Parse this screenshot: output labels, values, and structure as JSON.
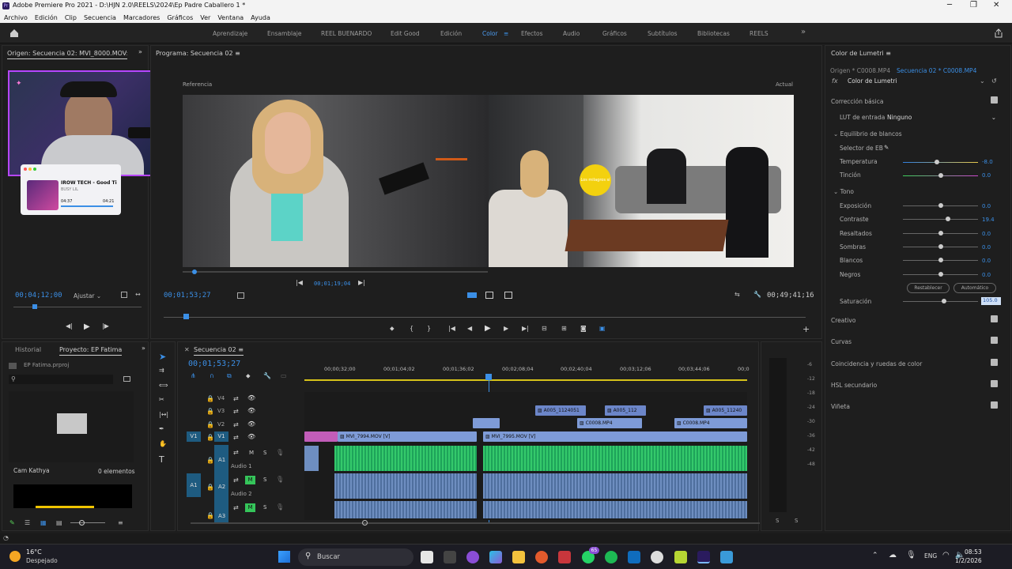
{
  "window": {
    "title": "Adobe Premiere Pro 2021 - D:\\HJN 2.0\\REELS\\2024\\Ep Padre Caballero 1 *",
    "minimize": "─",
    "maximize": "❐",
    "close": "✕"
  },
  "menu": [
    "Archivo",
    "Edición",
    "Clip",
    "Secuencia",
    "Marcadores",
    "Gráficos",
    "Ver",
    "Ventana",
    "Ayuda"
  ],
  "workspaces": [
    {
      "label": "Aprendizaje"
    },
    {
      "label": "Ensamblaje"
    },
    {
      "label": "REEL BUENARDO"
    },
    {
      "label": "Edit Good"
    },
    {
      "label": "Edición"
    },
    {
      "label": "Color",
      "active": true
    },
    {
      "label": "Efectos"
    },
    {
      "label": "Audio"
    },
    {
      "label": "Gráficos"
    },
    {
      "label": "Subtítulos"
    },
    {
      "label": "Bibliotecas"
    },
    {
      "label": "REELS"
    }
  ],
  "workspace_more": "»",
  "source": {
    "tab": "Origen: Secuencia 02: MVI_8000.MOV: 00;46;0",
    "timecode": "00;04;12;00",
    "fit": "Ajustar",
    "overlay_player": {
      "title": "IROW TECH - Good Ti",
      "sub": "BUSY LIL",
      "t1": "04:37",
      "t2": "04:21"
    }
  },
  "program": {
    "tab": "Programa: Secuencia 02",
    "ref_label": "Referencia",
    "cur_label": "Actual",
    "ref_timecode": "00;01;19;04",
    "timecode": "00;01;53;27",
    "duration": "00;49;41;16",
    "mug_text": "Los milagros sí"
  },
  "project": {
    "tab_history": "Historial",
    "tab_project": "Proyecto: EP Fatima",
    "file": "EP Fatima.prproj",
    "bin_name": "Cam Kathya",
    "count": "0 elementos"
  },
  "timeline": {
    "tab": "Secuencia 02",
    "timecode": "00;01;53;27",
    "ruler": [
      "00;00;32;00",
      "00;01;04;02",
      "00;01;36;02",
      "00;02;08;04",
      "00;02;40;04",
      "00;03;12;06",
      "00;03;44;06",
      "00;0"
    ],
    "tracks_video": [
      "V4",
      "V3",
      "V2",
      "V1"
    ],
    "tracks_audio": [
      "A1",
      "A2",
      "A3"
    ],
    "audio_names": [
      "Audio 1",
      "Audio 2"
    ],
    "src_patch": {
      "v": "V1",
      "a": "A1"
    },
    "clips": {
      "v1a": "MVI_7994.MOV [V]",
      "v1b": "MVI_7995.MOV [V]",
      "v2a": "C0008.MP4",
      "v2b": "C0008.MP4",
      "v3a": "A005_1124051",
      "v3b": "A005_112",
      "v3c": "A005_11240"
    },
    "meter_db": [
      "-6",
      "-12",
      "-18",
      "-24",
      "-30",
      "-36",
      "-42",
      "-48"
    ]
  },
  "lumetri": {
    "tab": "Color de Lumetri",
    "origin": "Origen * C0008.MP4",
    "seq": "Secuencia 02 * C0008.MP4",
    "effect": "Color de Lumetri",
    "basic": "Corrección básica",
    "lut_label": "LUT de entrada",
    "lut_value": "Ninguno",
    "wb": "Equilibrio de blancos",
    "wb_picker": "Selector de EB",
    "temp": {
      "label": "Temperatura",
      "value": "-8.0",
      "pos": 0.45
    },
    "tint": {
      "label": "Tinción",
      "value": "0.0",
      "pos": 0.5
    },
    "tone": "Tono",
    "sliders": [
      {
        "label": "Exposición",
        "value": "0.0",
        "pos": 0.5
      },
      {
        "label": "Contraste",
        "value": "19.4",
        "pos": 0.6
      },
      {
        "label": "Resaltados",
        "value": "0.0",
        "pos": 0.5
      },
      {
        "label": "Sombras",
        "value": "0.0",
        "pos": 0.5
      },
      {
        "label": "Blancos",
        "value": "0.0",
        "pos": 0.5
      },
      {
        "label": "Negros",
        "value": "0.0",
        "pos": 0.5
      }
    ],
    "reset": "Restablecer",
    "auto": "Automático",
    "saturation": {
      "label": "Saturación",
      "value": "105.0",
      "pos": 0.55
    },
    "sections": [
      "Creativo",
      "Curvas",
      "Coincidencia y ruedas de color",
      "HSL secundario",
      "Viñeta"
    ]
  },
  "taskbar": {
    "temp": "16°C",
    "weather": "Despejado",
    "search": "Buscar",
    "lang": "ENG",
    "time": "08:53",
    "date": "1/2/2026",
    "badge": "65"
  }
}
